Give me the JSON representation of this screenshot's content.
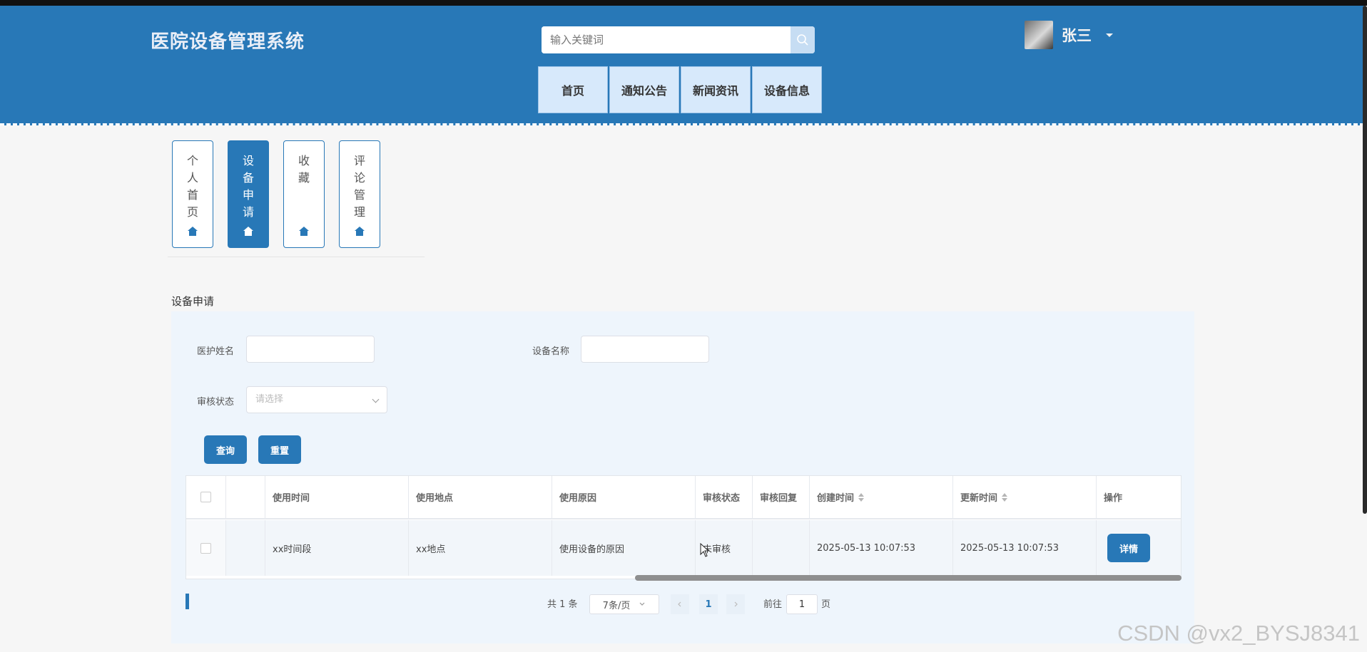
{
  "app": {
    "title": "医院设备管理系统"
  },
  "search": {
    "placeholder": "输入关键词"
  },
  "user": {
    "name": "张三"
  },
  "nav": {
    "items": [
      "首页",
      "通知公告",
      "新闻资讯",
      "设备信息"
    ]
  },
  "sidebar": {
    "items": [
      {
        "label": "个人首页",
        "active": false
      },
      {
        "label": "设备申请",
        "active": true
      },
      {
        "label": "收藏",
        "active": false
      },
      {
        "label": "评论管理",
        "active": false
      }
    ]
  },
  "section": {
    "title": "设备申请"
  },
  "filters": {
    "staff_name_label": "医护姓名",
    "device_name_label": "设备名称",
    "review_status_label": "审核状态",
    "review_status_placeholder": "请选择",
    "query_button": "查询",
    "reset_button": "重置"
  },
  "table": {
    "columns": [
      "使用时间",
      "使用地点",
      "使用原因",
      "审核状态",
      "审核回复",
      "创建时间",
      "更新时间",
      "操作"
    ],
    "rows": [
      {
        "use_time": "xx时间段",
        "location": "xx地点",
        "reason": "使用设备的原因",
        "status": "未审核",
        "reply": "",
        "created": "2025-05-13 10:07:53",
        "updated": "2025-05-13 10:07:53",
        "action": "详情"
      }
    ]
  },
  "pagination": {
    "total": "共 1 条",
    "page_size": "7条/页",
    "current": "1",
    "goto_prefix": "前往",
    "goto_value": "1",
    "goto_suffix": "页"
  },
  "watermark": "CSDN @vx2_BYSJ8341",
  "colors": {
    "primary": "#2878b7",
    "nav_bg": "#d7e9fb",
    "panel_bg": "#eef5fc"
  }
}
